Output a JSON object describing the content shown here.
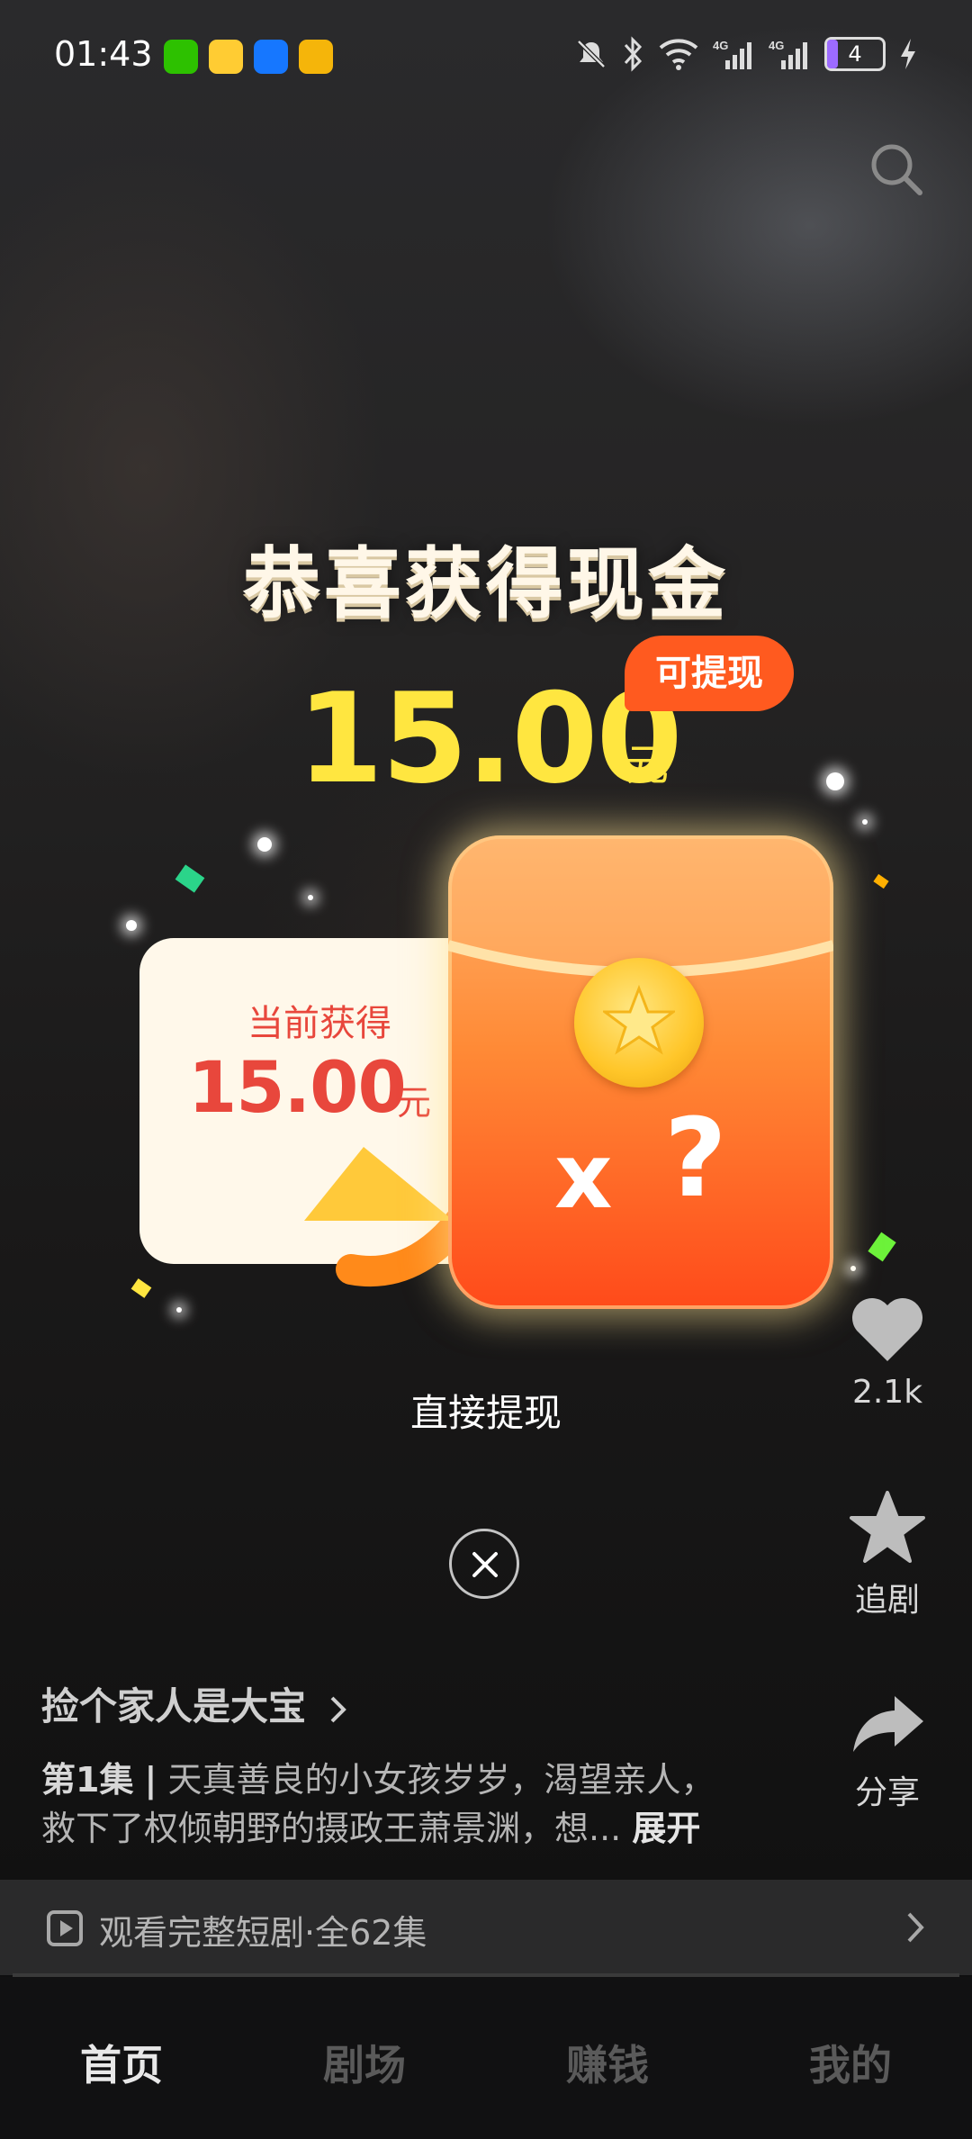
{
  "status_bar": {
    "time": "01:43",
    "battery": "4",
    "icons": [
      "wechat-icon",
      "weibo-icon",
      "alipay-icon",
      "mail-icon",
      "mute-icon",
      "bluetooth-icon",
      "wifi-icon",
      "signal-4g-icon",
      "signal-4g-icon",
      "battery-icon",
      "charging-icon"
    ],
    "network_label": "4G"
  },
  "reward": {
    "title": "恭喜获得现金",
    "amount": "15.00",
    "unit": "元",
    "badge": "可提现",
    "card_label": "当前获得",
    "card_amount": "15.00",
    "card_unit": "元",
    "envelope_multiplier": "x",
    "envelope_mystery": "?",
    "withdraw_label": "直接提现"
  },
  "side_actions": {
    "like_count": "2.1k",
    "follow_label": "追剧",
    "share_label": "分享"
  },
  "drama": {
    "title": "捡个家人是大宝",
    "episode": "第1集",
    "separator": "|",
    "description": "天真善良的小女孩岁岁，渴望亲人，救下了权倾朝野的摄政王萧景渊，想...",
    "expand_label": "展开"
  },
  "full_series": {
    "label": "观看完整短剧·全62集"
  },
  "tabs": [
    {
      "label": "首页",
      "active": true
    },
    {
      "label": "剧场",
      "active": false
    },
    {
      "label": "赚钱",
      "active": false
    },
    {
      "label": "我的",
      "active": false
    }
  ],
  "colors": {
    "gold": "#ffe640",
    "badge_orange": "#ff5a1f",
    "card_red": "#e8473c"
  }
}
